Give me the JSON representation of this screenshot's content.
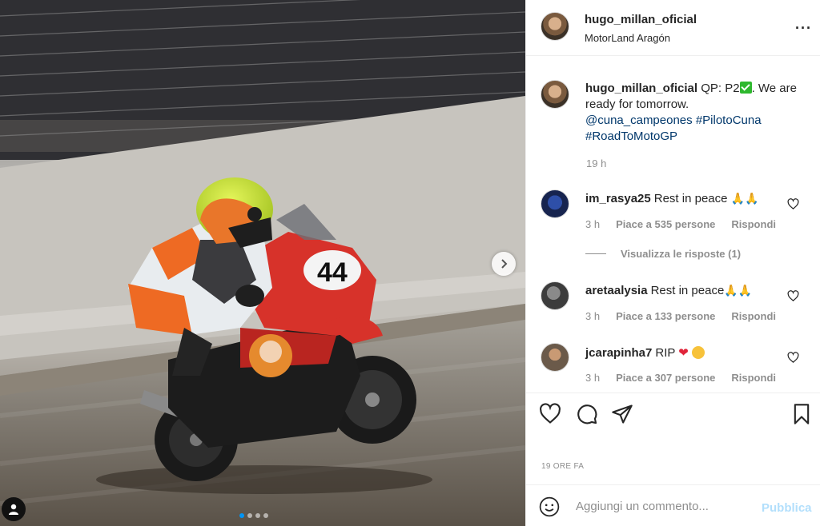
{
  "post": {
    "username": "hugo_millan_oficial",
    "location": "MotorLand Aragón",
    "more_icon": "more-options-icon",
    "caption_prefix": "QP: P2",
    "caption_rest": ". We are ready for tomorrow.",
    "mention": "@cuna_campeones",
    "hashtag1": "#PilotoCuna",
    "hashtag2": "#RoadToMotoGP",
    "caption_time": "19 h",
    "bike_number": "44",
    "carousel": {
      "dots": 4,
      "active_index": 0
    },
    "post_time": "19 ORE FA"
  },
  "comments": [
    {
      "user": "im_rasya25",
      "text": "Rest in peace",
      "emoji": "🙏🙏",
      "time": "3 h",
      "likes": "Piace a 535 persone",
      "reply": "Rispondi",
      "view_replies": "Visualizza le risposte (1)"
    },
    {
      "user": "aretaalysia",
      "text": "Rest in peace",
      "emoji": "🙏🙏",
      "time": "3 h",
      "likes": "Piace a 133 persone",
      "reply": "Rispondi"
    },
    {
      "user": "jcarapinha7",
      "text": "RIP",
      "emoji_heart": "❤",
      "time": "3 h",
      "likes": "Piace a 307 persone",
      "reply": "Rispondi"
    }
  ],
  "composer": {
    "placeholder": "Aggiungi un commento...",
    "publish": "Pubblica"
  },
  "colors": {
    "accent_blue": "#0095f6",
    "link_blue": "#00376b",
    "muted": "#8e8e8e",
    "publish_disabled": "#b2dffc",
    "bike_red": "#d7322a",
    "helmet_yellow": "#c9e62b"
  }
}
